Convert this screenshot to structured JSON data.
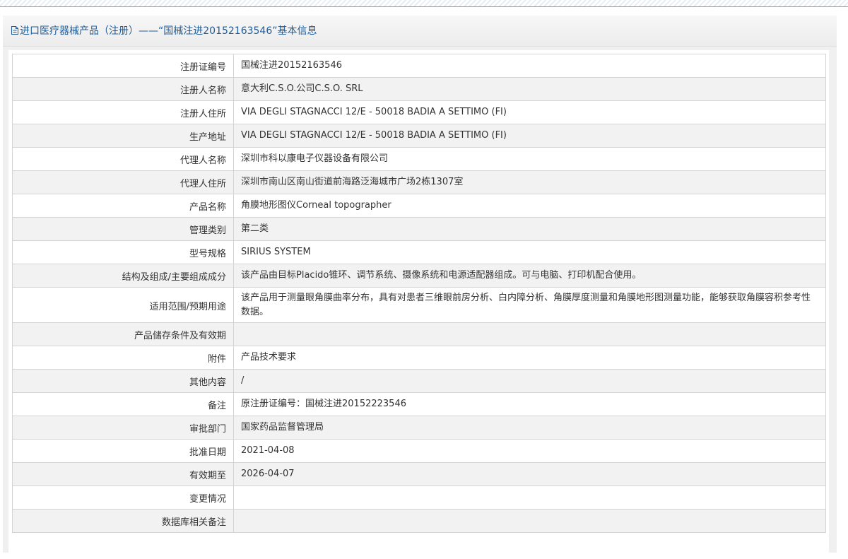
{
  "header": {
    "title": "进口医疗器械产品（注册）——“国械注进20152163546”基本信息"
  },
  "icons": {
    "title_icon": "document-icon"
  },
  "colors": {
    "title": "#1f5c99",
    "border": "#d4d4d4",
    "stripe_row": "#f2f2f2"
  },
  "rows": [
    {
      "label": "注册证编号",
      "value": "国械注进20152163546"
    },
    {
      "label": "注册人名称",
      "value": "意大利C.S.O.公司C.S.O. SRL"
    },
    {
      "label": "注册人住所",
      "value": "VIA DEGLI STAGNACCI 12/E - 50018 BADIA A SETTIMO (FI)"
    },
    {
      "label": "生产地址",
      "value": "VIA DEGLI STAGNACCI 12/E - 50018 BADIA A SETTIMO (FI)"
    },
    {
      "label": "代理人名称",
      "value": "深圳市科以康电子仪器设备有限公司"
    },
    {
      "label": "代理人住所",
      "value": "深圳市南山区南山街道前海路泛海城市广场2栋1307室"
    },
    {
      "label": "产品名称",
      "value": "角膜地形图仪Corneal topographer"
    },
    {
      "label": "管理类别",
      "value": "第二类"
    },
    {
      "label": "型号规格",
      "value": "SIRIUS SYSTEM"
    },
    {
      "label": "结构及组成/主要组成成分",
      "value": "该产品由目标Placido锥环、调节系统、摄像系统和电源适配器组成。可与电脑、打印机配合使用。"
    },
    {
      "label": "适用范围/预期用途",
      "value": "该产品用于测量眼角膜曲率分布，具有对患者三维眼前房分析、白内障分析、角膜厚度测量和角膜地形图测量功能，能够获取角膜容积参考性数据。"
    },
    {
      "label": "产品储存条件及有效期",
      "value": ""
    },
    {
      "label": "附件",
      "value": "产品技术要求"
    },
    {
      "label": "其他内容",
      "value": "/"
    },
    {
      "label": "备注",
      "value": "原注册证编号：国械注进20152223546"
    },
    {
      "label": "审批部门",
      "value": "国家药品监督管理局"
    },
    {
      "label": "批准日期",
      "value": "2021-04-08"
    },
    {
      "label": "有效期至",
      "value": "2026-04-07"
    },
    {
      "label": "变更情况",
      "value": ""
    },
    {
      "label": "数据库相关备注",
      "value": ""
    }
  ]
}
